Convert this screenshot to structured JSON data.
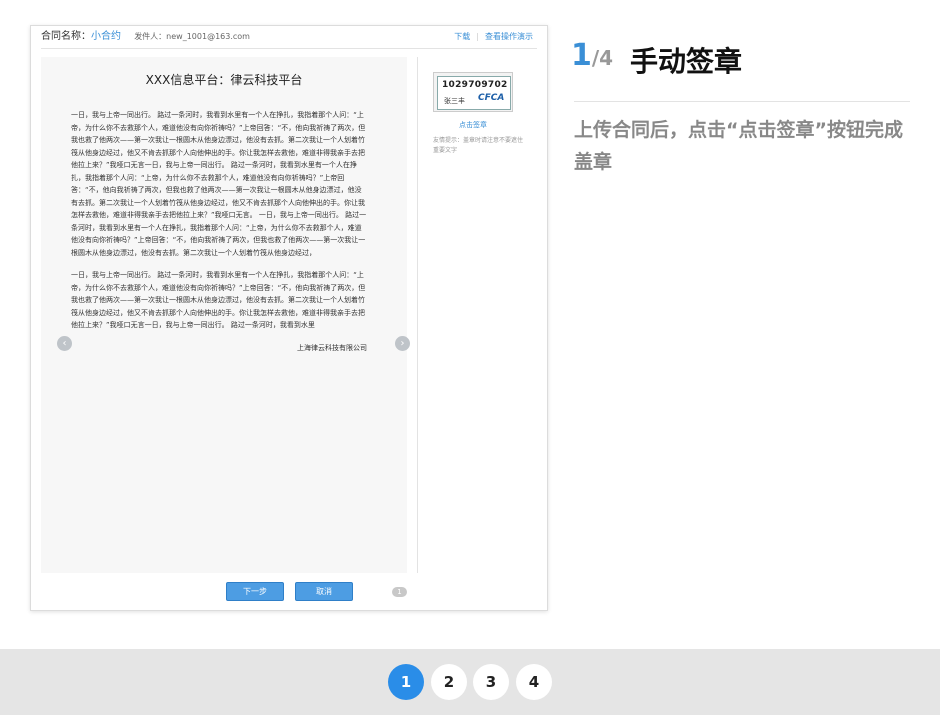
{
  "card": {
    "header": {
      "label": "合同名称：",
      "contract_name": "小合约",
      "sender": "发件人：new_1001@163.com",
      "download": "下载",
      "demo": "查看操作演示"
    },
    "document": {
      "title": "XXX信息平台：律云科技平台",
      "paragraphs": [
        "一日，我与上帝一同出行。 路过一条河时，我看到水里有一个人在挣扎，我指着那个人问：“上帝，为什么你不去救那个人，难道他没有向你祈祷吗？”上帝回答：“不，他向我祈祷了两次，但我也救了他两次——第一次我让一根圆木从他身边漂过，他没有去抓。第二次我让一个人划着竹筏从他身边经过，他又不肯去抓那个人向他伸出的手。你让我怎样去救他，难道非得我亲手去把他拉上来？”我哑口无言一日，我与上帝一同出行。 路过一条河时，我看到水里有一个人在挣扎，我指着那个人问：“上帝，为什么你不去救那个人，难道他没有向你祈祷吗？”上帝回答：“不，他向我祈祷了两次，但我也救了他两次——第一次我让一根圆木从他身边漂过，他没有去抓。第二次我让一个人划着竹筏从他身边经过，他又不肯去抓那个人向他伸出的手。你让我怎样去救他，难道非得我亲手去把他拉上来？”我哑口无言。 一日，我与上帝一同出行。 路过一条河时，我看到水里有一个人在挣扎，我指着那个人问：“上帝，为什么你不去救那个人，难道他没有向你祈祷吗？”上帝回答：“不，他向我祈祷了两次，但我也救了他两次——第一次我让一根圆木从他身边漂过，他没有去抓。第二次我让一个人划着竹筏从他身边经过，",
        "一日，我与上帝一同出行。 路过一条河时，我看到水里有一个人在挣扎，我指着那个人问：“上帝，为什么你不去救那个人，难道他没有向你祈祷吗？”上帝回答：“不，他向我祈祷了两次，但我也救了他两次——第一次我让一根圆木从他身边漂过，他没有去抓。第二次我让一个人划着竹筏从他身边经过，他又不肯去抓那个人向他伸出的手。你让我怎样去救他，难道非得我亲手去把他拉上来？”我哑口无言一日，我与上帝一同出行。 路过一条河时，我看到水里"
      ],
      "signature": "上海律云科技有限公司",
      "page_number": "1"
    },
    "seal": {
      "code": "1029709702",
      "person": "张三丰",
      "brand": "CFCA",
      "click_label": "点击签章",
      "tip": "友情提示：盖章时请注意不要遮住重要文字"
    },
    "buttons": {
      "next": "下一步",
      "cancel": "取消"
    }
  },
  "step": {
    "current": "1",
    "total": "/4",
    "title": "手动签章",
    "description": "上传合同后，点击“点击签章”按钮完成盖章"
  },
  "pagination": [
    "1",
    "2",
    "3",
    "4"
  ],
  "colors": {
    "accent": "#2a8de8",
    "link": "#3a8fd6"
  }
}
